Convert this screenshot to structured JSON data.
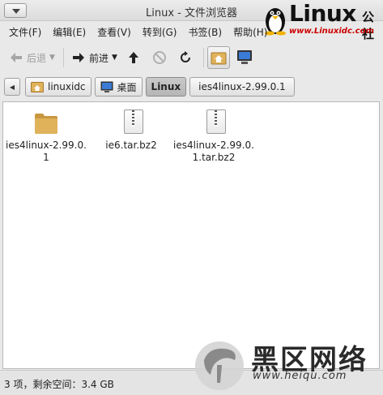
{
  "window": {
    "title": "Linux - 文件浏览器"
  },
  "logo": {
    "text": "Linux",
    "suffix": "公社",
    "url": "www.Linuxidc.com"
  },
  "menubar": {
    "items": [
      {
        "label": "文件(F)"
      },
      {
        "label": "编辑(E)"
      },
      {
        "label": "查看(V)"
      },
      {
        "label": "转到(G)"
      },
      {
        "label": "书签(B)"
      },
      {
        "label": "帮助(H)"
      }
    ]
  },
  "toolbar": {
    "back_label": "后退",
    "forward_label": "前进",
    "icons": {
      "back": "arrow-left-icon",
      "forward": "arrow-right-icon",
      "up": "arrow-up-icon",
      "stop": "stop-icon",
      "reload": "reload-icon",
      "home": "home-icon",
      "computer": "computer-icon"
    }
  },
  "location": {
    "crumbs": [
      {
        "label": "linuxidc",
        "icon": "home-folder-icon"
      },
      {
        "label": "桌面",
        "icon": "desktop-icon"
      },
      {
        "label": "Linux",
        "active": true
      },
      {
        "label": "ies4linux-2.99.0.1"
      }
    ]
  },
  "files": [
    {
      "name": "ies4linux-2.99.0.1",
      "type": "folder"
    },
    {
      "name": "ie6.tar.bz2",
      "type": "archive"
    },
    {
      "name": "ies4linux-2.99.0.1.tar.bz2",
      "type": "archive"
    }
  ],
  "statusbar": {
    "text": "3 项，剩余空间：3.4 GB"
  },
  "watermark": {
    "title": "黑区网络",
    "url": "www.heiqu.com"
  },
  "colors": {
    "folder": "#e0b25a",
    "accent_red": "#cc0000",
    "window_bg": "#e9e9e9"
  }
}
